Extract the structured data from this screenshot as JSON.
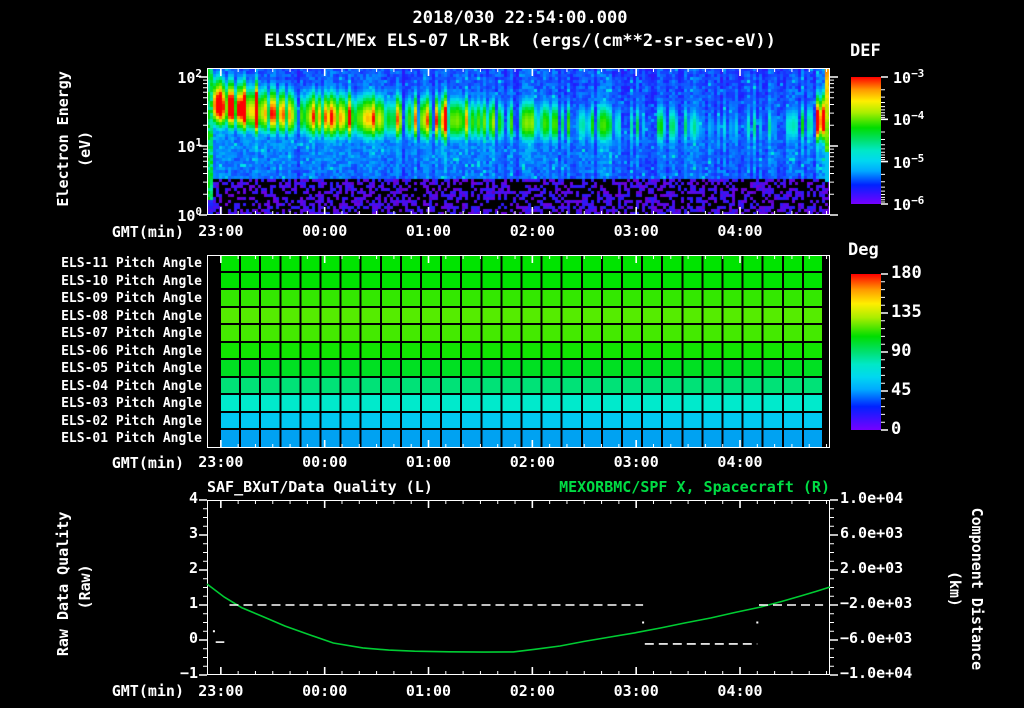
{
  "title": {
    "datetime": "2018/030 22:54:00.000",
    "instrument": "ELSSCIL/MEx ELS-07 LR-Bk  (ergs/(cm**2-sr-sec-eV))"
  },
  "time_axis": {
    "label": "GMT(min)",
    "hour_ticks": [
      "23:00",
      "00:00",
      "01:00",
      "02:00",
      "03:00",
      "04:00"
    ],
    "start": "22:54",
    "span_minutes": 360,
    "first_tick_offset_min": 8,
    "minor_tick_min": 10
  },
  "spectrogram_panel": {
    "ylabel": "Electron Energy",
    "ylabel_units": "(eV)",
    "ytick_exponents": [
      2,
      1,
      0
    ],
    "colorbar": {
      "title": "DEF",
      "tick_exponents": [
        -3,
        -4,
        -5,
        -6
      ]
    }
  },
  "pitch_panel": {
    "rows": [
      {
        "label": "ELS-11 Pitch Angle",
        "deg": 97,
        "color": "#00e400"
      },
      {
        "label": "ELS-10 Pitch Angle",
        "deg": 97,
        "color": "#00e400"
      },
      {
        "label": "ELS-09 Pitch Angle",
        "deg": 103,
        "color": "#33e800"
      },
      {
        "label": "ELS-08 Pitch Angle",
        "deg": 107,
        "color": "#55ec00"
      },
      {
        "label": "ELS-07 Pitch Angle",
        "deg": 105,
        "color": "#44ea00"
      },
      {
        "label": "ELS-06 Pitch Angle",
        "deg": 99,
        "color": "#11e600"
      },
      {
        "label": "ELS-05 Pitch Angle",
        "deg": 92,
        "color": "#00e022"
      },
      {
        "label": "ELS-04 Pitch Angle",
        "deg": 84,
        "color": "#00e277"
      },
      {
        "label": "ELS-03 Pitch Angle",
        "deg": 74,
        "color": "#00eacc"
      },
      {
        "label": "ELS-02 Pitch Angle",
        "deg": 64,
        "color": "#00c8f2"
      },
      {
        "label": "ELS-01 Pitch Angle",
        "deg": 55,
        "color": "#00a2f2"
      }
    ],
    "colorbar": {
      "title": "Deg",
      "ticks": [
        180,
        135,
        90,
        45,
        0
      ]
    }
  },
  "bottom_panel": {
    "left_title": "SAF_BXuT/Data Quality (L)",
    "right_title": "MEXORBMC/SPF X, Spacecraft (R)",
    "right_title_color": "#00dd44",
    "curve_color": "#00cc33",
    "left_ylabel": "Raw Data Quality",
    "left_ylabel_units": "(Raw)",
    "right_ylabel": "Component Distance",
    "right_ylabel_units": "(km)",
    "left_ticks": [
      4,
      3,
      2,
      1,
      0,
      -1
    ],
    "right_ticks": [
      "1.0e+04",
      "6.0e+03",
      "2.0e+03",
      "-2.0e+03",
      "-6.0e+03",
      "-1.0e+04"
    ]
  },
  "chart_data": [
    {
      "type": "heatmap",
      "title": "ELSSCIL/MEx ELS-07 LR-Bk",
      "units": "ergs/(cm**2-sr-sec-eV)",
      "x_start": "22:54",
      "x_end": "04:54",
      "ylabel": "Electron Energy (eV)",
      "yscale": "log",
      "ylim": [
        1,
        135
      ],
      "colorbar": {
        "title": "DEF",
        "min": 1e-06,
        "max": 0.001
      },
      "description": "Bright 10-60 eV electron band, strongest (green-yellow) 23:00-01:10, patchy cyan with dropouts after 02:00, bright column at right edge; blue noise above band, black with violet speckles below 3 eV",
      "band_center_logE": [
        1.62,
        1.56,
        1.5,
        1.47,
        1.44,
        1.42,
        1.42,
        1.4,
        1.4,
        1.38,
        1.38,
        1.36,
        1.35,
        1.35,
        1.33,
        1.32,
        1.32,
        1.3,
        1.3,
        1.3,
        1.28,
        1.28,
        1.28,
        1.3,
        1.32,
        1.4
      ],
      "band_intensity": [
        0.9,
        0.95,
        0.88,
        0.85,
        0.88,
        0.86,
        0.84,
        0.8,
        0.82,
        0.8,
        0.76,
        0.72,
        0.62,
        0.66,
        0.7,
        0.58,
        0.62,
        0.55,
        0.66,
        0.6,
        0.42,
        0.52,
        0.45,
        0.5,
        0.55,
        0.9
      ],
      "gap_probability": [
        0.02,
        0.02,
        0.03,
        0.03,
        0.04,
        0.05,
        0.05,
        0.06,
        0.08,
        0.08,
        0.1,
        0.14,
        0.2,
        0.16,
        0.12,
        0.22,
        0.2,
        0.28,
        0.16,
        0.22,
        0.45,
        0.28,
        0.32,
        0.3,
        0.22,
        0.06
      ],
      "noise_seed": 42
    },
    {
      "type": "heatmap",
      "title": "ELS Pitch Angles",
      "rows": [
        "ELS-11",
        "ELS-10",
        "ELS-09",
        "ELS-08",
        "ELS-07",
        "ELS-06",
        "ELS-05",
        "ELS-04",
        "ELS-03",
        "ELS-02",
        "ELS-01"
      ],
      "values_deg": [
        97,
        97,
        103,
        107,
        105,
        99,
        92,
        84,
        74,
        64,
        55
      ],
      "colorbar": {
        "title": "Deg",
        "min": 0,
        "max": 180
      }
    },
    {
      "type": "line",
      "x_unit": "minutes since 22:54",
      "left_ylim": [
        -1,
        4
      ],
      "right_ylim": [
        -10000,
        10000
      ],
      "series": [
        {
          "name": "SAF_BXuT/Data Quality (L)",
          "axis": "left",
          "style": "dashed-white",
          "segments": [
            {
              "y": -0.06,
              "t": [
                5,
                10
              ]
            },
            {
              "y": 1.0,
              "t": [
                13,
                252
              ]
            },
            {
              "y": -0.11,
              "t": [
                253,
                318
              ]
            },
            {
              "y": 1.0,
              "t": [
                319,
                356
              ]
            }
          ],
          "points": [
            {
              "t": 4,
              "y": 0.25
            },
            {
              "t": 252,
              "y": 0.5
            },
            {
              "t": 318,
              "y": 0.5
            }
          ]
        },
        {
          "name": "MEXORBMC/SPF X, Spacecraft (R)",
          "axis": "right",
          "points_t": [
            0,
            10,
            20,
            32,
            45,
            60,
            73,
            90,
            105,
            120,
            140,
            160,
            177,
            190,
            204,
            218,
            233,
            248,
            262,
            276,
            291,
            305,
            320,
            332,
            343,
            352,
            360
          ],
          "points_km": [
            400,
            -1100,
            -2300,
            -3300,
            -4400,
            -5450,
            -6340,
            -6900,
            -7150,
            -7280,
            -7350,
            -7380,
            -7360,
            -7050,
            -6690,
            -6160,
            -5660,
            -5150,
            -4630,
            -4060,
            -3490,
            -2860,
            -2230,
            -1600,
            -970,
            -450,
            60
          ]
        }
      ]
    }
  ]
}
